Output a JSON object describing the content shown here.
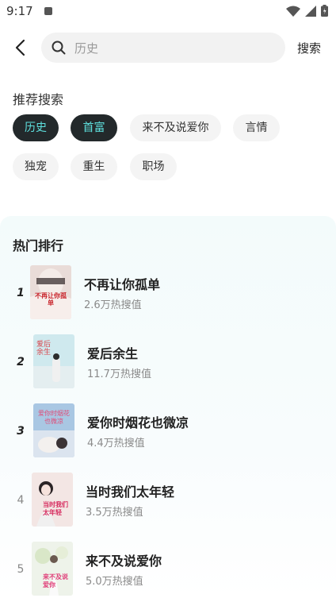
{
  "status": {
    "time": "9:17"
  },
  "header": {
    "search_placeholder": "历史",
    "search_label": "搜索"
  },
  "recommend": {
    "title": "推荐搜索",
    "tags": [
      {
        "label": "历史",
        "active": true
      },
      {
        "label": "首富",
        "active": true
      },
      {
        "label": "来不及说爱你",
        "active": false
      },
      {
        "label": "言情",
        "active": false
      },
      {
        "label": "独宠",
        "active": false
      },
      {
        "label": "重生",
        "active": false
      },
      {
        "label": "职场",
        "active": false
      }
    ]
  },
  "hot": {
    "title": "热门排行",
    "items": [
      {
        "rank": "1",
        "title": "不再让你孤单",
        "heat": "2.6万热搜值",
        "cover_text": "不再让你孤单"
      },
      {
        "rank": "2",
        "title": "爱后余生",
        "heat": "11.7万热搜值",
        "cover_text": "爱后余生"
      },
      {
        "rank": "3",
        "title": "爱你时烟花也微凉",
        "heat": "4.4万热搜值",
        "cover_text": "爱你时烟花也微凉"
      },
      {
        "rank": "4",
        "title": "当时我们太年轻",
        "heat": "3.5万热搜值",
        "cover_text": "当时我们太年轻"
      },
      {
        "rank": "5",
        "title": "来不及说爱你",
        "heat": "5.0万热搜值",
        "cover_text": "来不及说爱你"
      }
    ]
  },
  "colors": {
    "active_tag_bg": "#23292b",
    "active_tag_text": "#5ee0de",
    "panel_bg": "#f3fbfb"
  }
}
